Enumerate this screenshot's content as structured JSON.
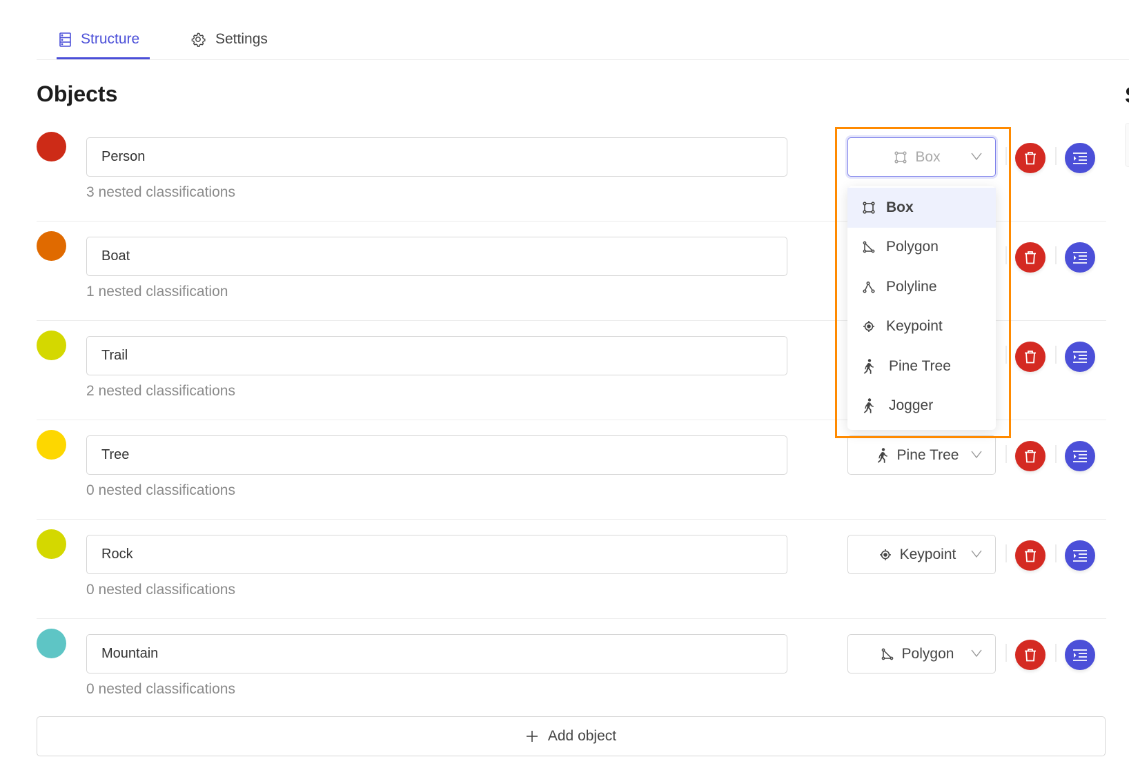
{
  "tabs": [
    {
      "label": "Structure",
      "icon": "structure-icon",
      "active": true
    },
    {
      "label": "Settings",
      "icon": "gear-icon",
      "active": false
    }
  ],
  "heading": "Objects",
  "accent_color": "#4b4fd8",
  "delete_color": "#d42a22",
  "objects": [
    {
      "name": "Person",
      "color": "#cd2b17",
      "nested": "3 nested classifications",
      "shape": "Box",
      "shape_icon": "box-icon",
      "open": true
    },
    {
      "name": "Boat",
      "color": "#e06a00",
      "nested": "1 nested classification",
      "shape": "",
      "shape_icon": ""
    },
    {
      "name": "Trail",
      "color": "#d4d800",
      "nested": "2 nested classifications",
      "shape": "",
      "shape_icon": ""
    },
    {
      "name": "Tree",
      "color": "#fdd700",
      "nested": "0 nested classifications",
      "shape": "Pine Tree",
      "shape_icon": "person-walking-icon"
    },
    {
      "name": "Rock",
      "color": "#d4d800",
      "nested": "0 nested classifications",
      "shape": "Keypoint",
      "shape_icon": "keypoint-icon"
    },
    {
      "name": "Mountain",
      "color": "#5ec5c5",
      "nested": "0 nested classifications",
      "shape": "Polygon",
      "shape_icon": "polygon-icon"
    }
  ],
  "dropdown": {
    "selected": "Box",
    "options": [
      {
        "label": "Box",
        "icon": "box-icon"
      },
      {
        "label": "Polygon",
        "icon": "polygon-icon"
      },
      {
        "label": "Polyline",
        "icon": "polyline-icon"
      },
      {
        "label": "Keypoint",
        "icon": "keypoint-icon"
      },
      {
        "label": "Pine Tree",
        "icon": "person-walking-icon"
      },
      {
        "label": "Jogger",
        "icon": "person-walking-icon"
      }
    ]
  },
  "add_object_label": "Add object",
  "right_panel_heading_partial": "S",
  "highlight_color": "#ff8a00"
}
